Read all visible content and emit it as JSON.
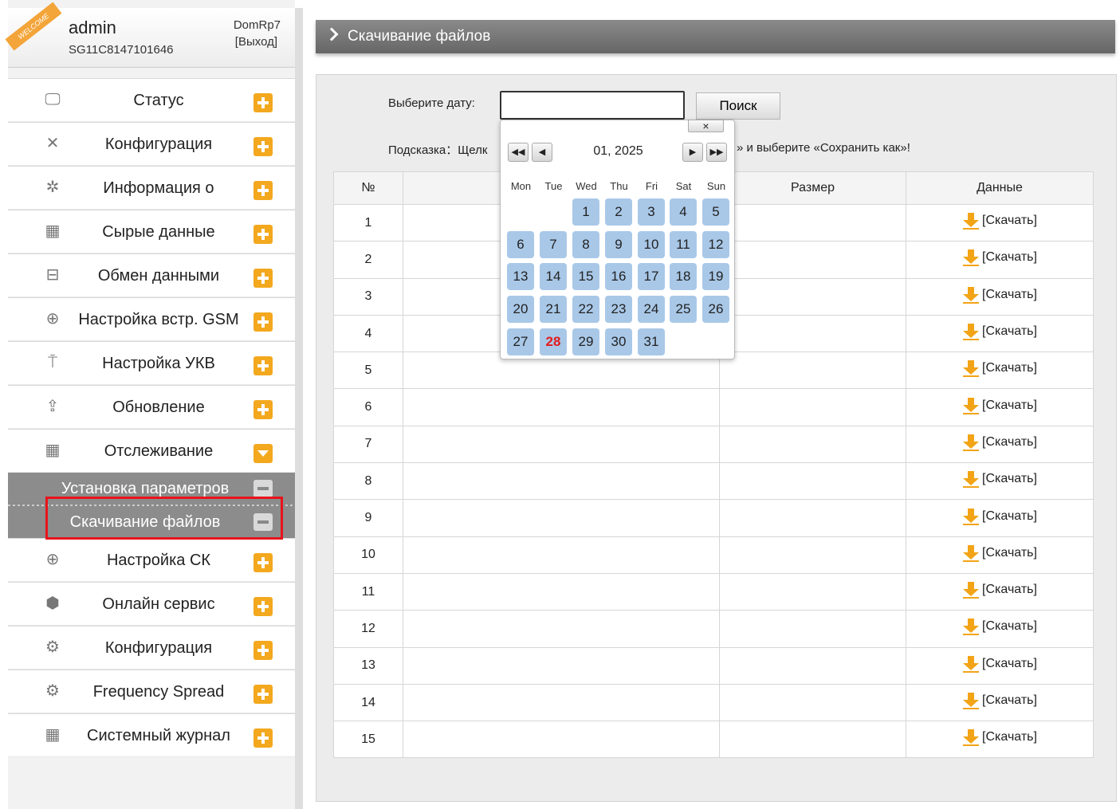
{
  "header": {
    "welcome_badge": "WELCOME",
    "username": "admin",
    "serial": "SG11C8147101646",
    "device_name": "DomRp7",
    "logout_label": "[Выход]"
  },
  "sidebar": {
    "items": [
      {
        "label": "Статус",
        "icon": "monitor-icon",
        "toggle": "plus"
      },
      {
        "label": "Конфигурация",
        "icon": "tools-icon",
        "toggle": "plus"
      },
      {
        "label": "Информация о",
        "icon": "satellite-icon",
        "toggle": "plus"
      },
      {
        "label": "Сырые данные",
        "icon": "calendar-icon",
        "toggle": "plus"
      },
      {
        "label": "Обмен данными",
        "icon": "network-icon",
        "toggle": "plus"
      },
      {
        "label": "Настройка встр. GSM",
        "icon": "globe-icon",
        "toggle": "plus"
      },
      {
        "label": "Настройка УКВ",
        "icon": "antenna-icon",
        "toggle": "plus"
      },
      {
        "label": "Обновление",
        "icon": "upload-icon",
        "toggle": "plus"
      },
      {
        "label": "Отслеживание",
        "icon": "calendar-icon",
        "toggle": "down"
      }
    ],
    "subitems": [
      {
        "label": "Установка параметров"
      },
      {
        "label": "Скачивание файлов"
      }
    ],
    "items_after": [
      {
        "label": "Настройка СК",
        "icon": "globe-icon",
        "toggle": "plus"
      },
      {
        "label": "Онлайн сервис",
        "icon": "cube-icon",
        "toggle": "plus"
      },
      {
        "label": "Конфигурация",
        "icon": "users-gear-icon",
        "toggle": "plus"
      },
      {
        "label": "Frequency Spread",
        "icon": "users-gear-icon",
        "toggle": "plus"
      },
      {
        "label": "Системный журнал",
        "icon": "calendar-icon",
        "toggle": "plus"
      }
    ]
  },
  "main": {
    "title": "Скачивание файлов",
    "date_label": "Выберите дату:",
    "date_value": "",
    "search_label": "Поиск",
    "hint_start": "Подсказка：Щелк",
    "hint_end": "» и выберите «Сохранить как»!",
    "table": {
      "headers": [
        "№",
        "",
        "",
        "Размер",
        "Данные"
      ],
      "download_label": "[Скачать]",
      "rows": [
        "1",
        "2",
        "3",
        "4",
        "5",
        "6",
        "7",
        "8",
        "9",
        "10",
        "11",
        "12",
        "13",
        "14",
        "15"
      ]
    }
  },
  "calendar": {
    "close_label": "×",
    "prev_year_label": "◀◀",
    "prev_month_label": "◀",
    "next_month_label": "▶",
    "next_year_label": "▶▶",
    "title": "01, 2025",
    "weekdays": [
      "Mon",
      "Tue",
      "Wed",
      "Thu",
      "Fri",
      "Sat",
      "Sun"
    ],
    "first_weekday_index": 2,
    "days_in_month": 31,
    "today": 28
  },
  "colors": {
    "accent_orange": "#f3a81e",
    "highlight_red": "#e8141b",
    "calendar_day_bg": "#a9c8e8",
    "today_red": "#e21b1b"
  }
}
